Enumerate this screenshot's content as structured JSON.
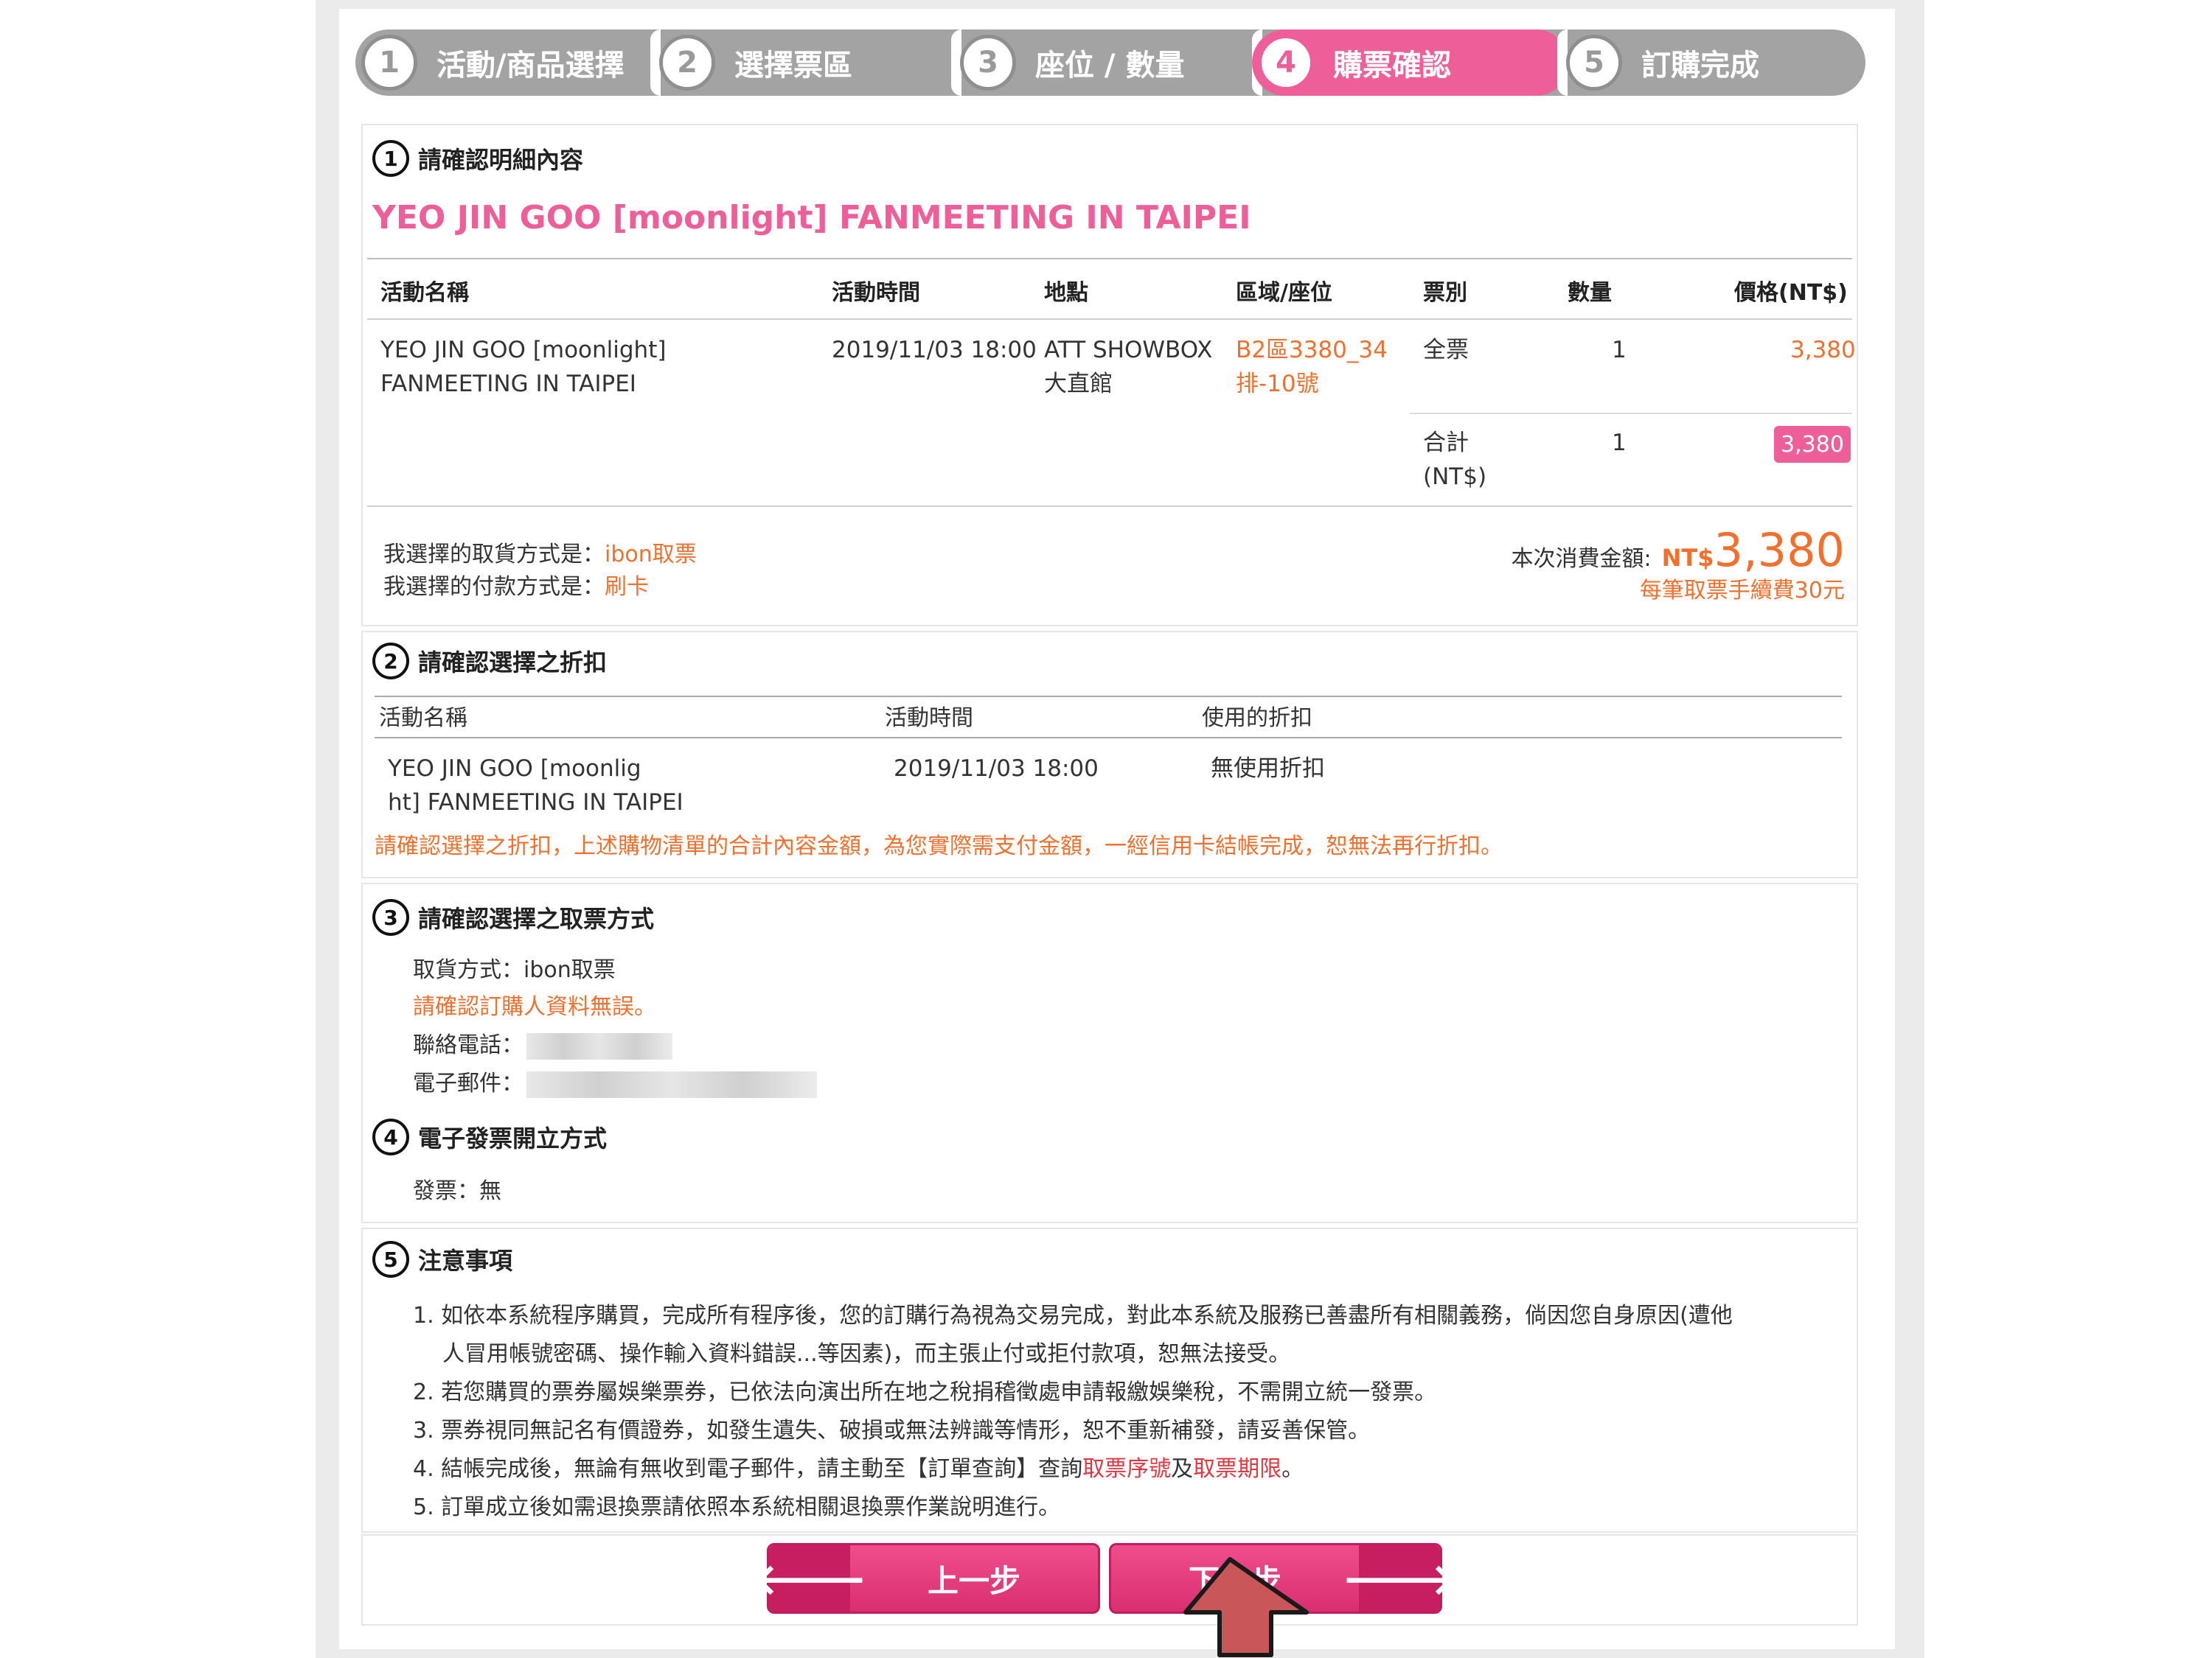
{
  "steps": [
    {
      "num": "1",
      "label": "活動/商品選擇"
    },
    {
      "num": "2",
      "label": "選擇票區"
    },
    {
      "num": "3",
      "label": "座位 / 數量"
    },
    {
      "num": "4",
      "label": "購票確認"
    },
    {
      "num": "5",
      "label": "訂購完成"
    }
  ],
  "section1": {
    "num": "1",
    "title": "請確認明細內容",
    "event_title": "YEO JIN GOO [moonlight] FANMEETING IN TAIPEI",
    "headers": [
      "活動名稱",
      "活動時間",
      "地點",
      "區域/座位",
      "票別",
      "數量",
      "價格(NT$)"
    ],
    "row": {
      "name_line1": "YEO JIN GOO [moonlight]",
      "name_line2": "FANMEETING IN TAIPEI",
      "time": "2019/11/03 18:00",
      "venue_line1": "ATT SHOWBOX",
      "venue_line2": "大直館",
      "seat_line1": "B2區3380_34",
      "seat_line2": "排-10號",
      "ticket_type": "全票",
      "qty": "1",
      "price": "3,380"
    },
    "total": {
      "label_line1": "合計",
      "label_line2": "(NT$)",
      "qty": "1",
      "amount": "3,380"
    },
    "pickup_label": "我選擇的取貨方式是：",
    "pickup_value": "ibon取票",
    "payment_label": "我選擇的付款方式是：",
    "payment_value": "刷卡",
    "amount_label": "本次消費金額:",
    "amount_currency": "NT$",
    "amount_value": "3,380",
    "fee_note": "每筆取票手續費30元"
  },
  "section2": {
    "num": "2",
    "title": "請確認選擇之折扣",
    "headers": [
      "活動名稱",
      "活動時間",
      "使用的折扣"
    ],
    "row": {
      "name_line1": "YEO JIN GOO [moonlig",
      "name_line2": "ht] FANMEETING IN TAIPEI",
      "time": "2019/11/03 18:00",
      "discount": "無使用折扣"
    },
    "warning": "請確認選擇之折扣，上述購物清單的合計內容金額，為您實際需支付金額，一經信用卡結帳完成，恕無法再行折扣。"
  },
  "section3": {
    "num": "3",
    "title": "請確認選擇之取票方式",
    "pickup_label": "取貨方式：",
    "pickup_value": "ibon取票",
    "confirm_note": "請確認訂購人資料無誤。",
    "phone_label": "聯絡電話：",
    "email_label": "電子郵件："
  },
  "section4": {
    "num": "4",
    "title": "電子發票開立方式",
    "invoice_label": "發票：",
    "invoice_value": "無"
  },
  "section5": {
    "num": "5",
    "title": "注意事項",
    "notes": {
      "n1a": "1. 如依本系統程序購買，完成所有程序後，您的訂購行為視為交易完成，對此本系統及服務已善盡所有相關義務，倘因您自身原因(遭他",
      "n1b": "人冒用帳號密碼、操作輸入資料錯誤...等因素)，而主張止付或拒付款項，恕無法接受。",
      "n2": "2. 若您購買的票券屬娛樂票券，已依法向演出所在地之稅捐稽徵處申請報繳娛樂稅，不需開立統一發票。",
      "n3": "3. 票券視同無記名有價證券，如發生遺失、破損或無法辨識等情形，恕不重新補發，請妥善保管。",
      "n4_pre": "4. 結帳完成後，無論有無收到電子郵件，請主動至【訂單查詢】查詢",
      "n4_link1": "取票序號",
      "n4_mid": "及",
      "n4_link2": "取票期限",
      "n4_post": "。",
      "n5": "5. 訂單成立後如需退換票請依照本系統相關退換票作業說明進行。"
    }
  },
  "buttons": {
    "prev_label": "上一步",
    "next_label": "下一步",
    "prev_arrow": "🡐",
    "next_arrow": "🡒"
  },
  "colors": {
    "accent": "#ee5f9a",
    "orange": "#f26f2c",
    "red": "#e5363f"
  }
}
